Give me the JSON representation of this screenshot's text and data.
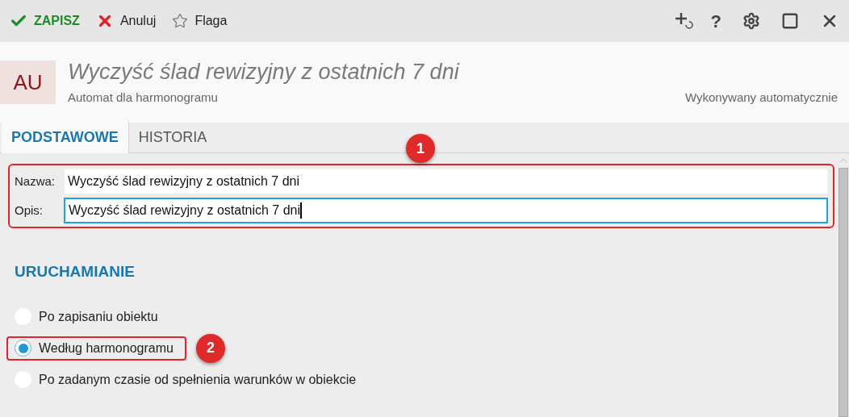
{
  "toolbar": {
    "actions": [
      {
        "kind": "save",
        "label": "ZAPISZ"
      },
      {
        "kind": "cancel",
        "label": "Anuluj"
      },
      {
        "kind": "flag",
        "label": "Flaga"
      }
    ],
    "help": "?"
  },
  "header": {
    "badge": "AU",
    "title": "Wyczyść ślad rewizyjny z ostatnich 7 dni",
    "subtitle": "Automat dla harmonogramu",
    "mode": "Wykonywany automatycznie"
  },
  "tabs": [
    {
      "label": "PODSTAWOWE",
      "selected": true
    },
    {
      "label": "HISTORIA",
      "selected": false
    }
  ],
  "fields": [
    {
      "label": "Nazwa:",
      "value": "Wyczyść ślad rewizyjny z ostatnich 7 dni",
      "focused": false
    },
    {
      "label": "Opis:",
      "value": "Wyczyść ślad rewizyjny z ostatnich 7 dni",
      "focused": true
    }
  ],
  "section": {
    "title": "URUCHAMIANIE",
    "options": [
      {
        "label": "Po zapisaniu obiektu",
        "selected": false
      },
      {
        "label": "Według harmonogramu",
        "selected": true
      },
      {
        "label": "Po zadanym czasie od spełnienia warunków w obiekcie",
        "selected": false
      }
    ]
  },
  "callouts": [
    "1",
    "2"
  ]
}
